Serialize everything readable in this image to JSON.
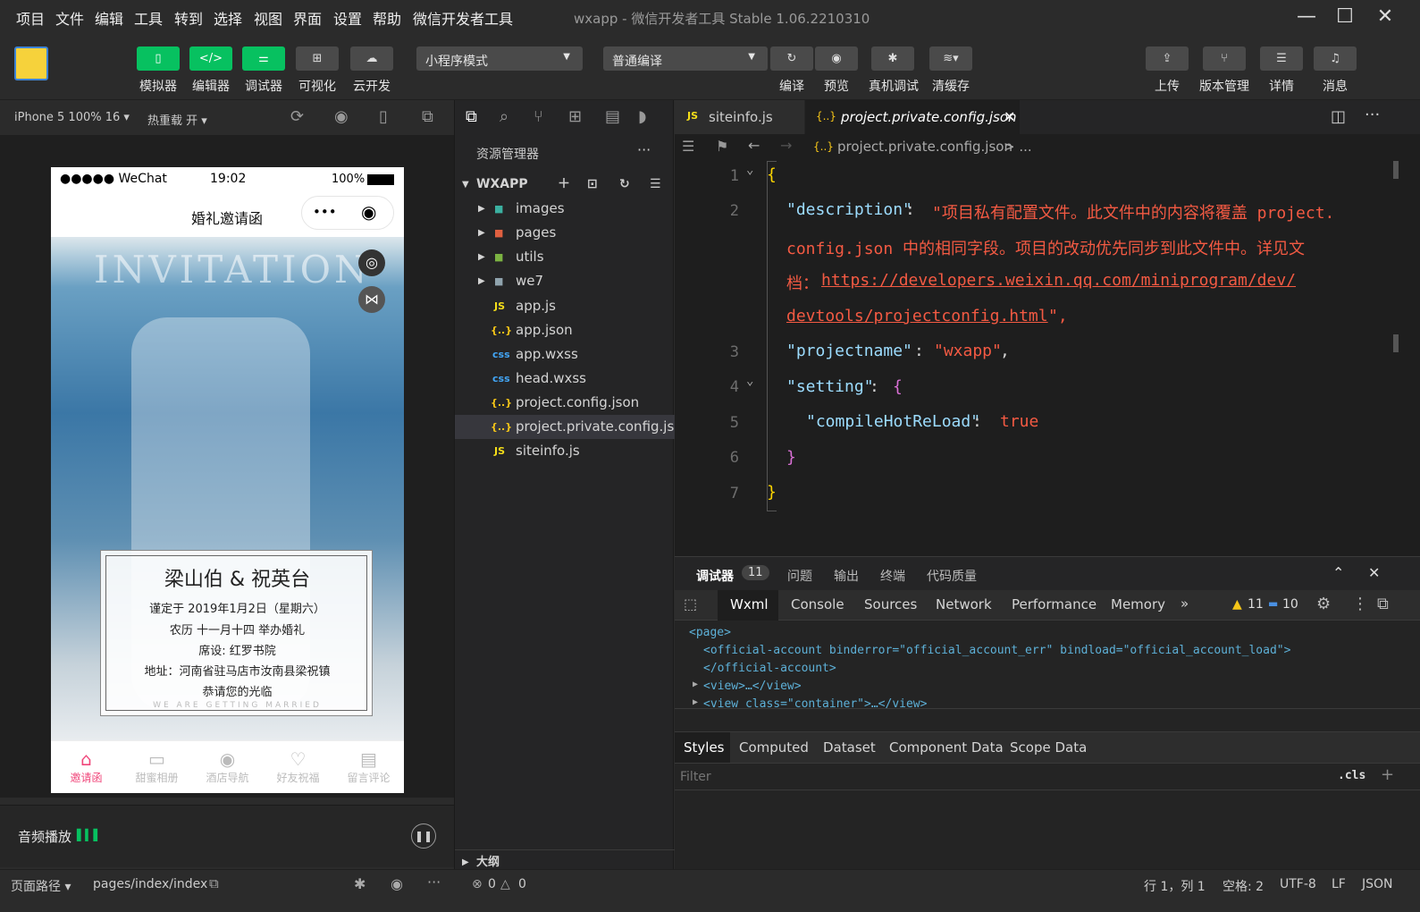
{
  "menu": [
    "项目",
    "文件",
    "编辑",
    "工具",
    "转到",
    "选择",
    "视图",
    "界面",
    "设置",
    "帮助",
    "微信开发者工具"
  ],
  "window_title": "wxapp - 微信开发者工具 Stable 1.06.2210310",
  "toolbar": {
    "simulator": "模拟器",
    "editor": "编辑器",
    "debugger": "调试器",
    "visual": "可视化",
    "cloud": "云开发",
    "mode_select": "小程序模式",
    "compile_select": "普通编译",
    "compile": "编译",
    "preview": "预览",
    "real_debug": "真机调试",
    "clear_cache": "清缓存",
    "upload": "上传",
    "version": "版本管理",
    "details": "详情",
    "messages": "消息"
  },
  "simulator": {
    "device": "iPhone 5 100% 16",
    "hot_reload": "热重载 开",
    "status_carrier": "●●●●● WeChat",
    "status_time": "19:02",
    "status_battery": "100%",
    "page_title": "婚礼邀请函",
    "banner_text": "INVITATION",
    "names": "梁山伯  &  祝英台",
    "card_lines": [
      "谨定于 2019年1月2日（星期六）",
      "农历 十一月十四 举办婚礼",
      "席设: 红罗书院",
      "地址：河南省驻马店市汝南县梁祝镇",
      "恭请您的光临"
    ],
    "card_footer": "WE ARE GETTING MARRIED",
    "tabs": [
      "邀请函",
      "甜蜜相册",
      "酒店导航",
      "好友祝福",
      "留言评论"
    ],
    "audio_label": "音频播放"
  },
  "explorer": {
    "title": "资源管理器",
    "root": "WXAPP",
    "folders": [
      "images",
      "pages",
      "utils",
      "we7"
    ],
    "files": [
      {
        "name": "app.js",
        "type": "JS"
      },
      {
        "name": "app.json",
        "type": "{..}"
      },
      {
        "name": "app.wxss",
        "type": "css"
      },
      {
        "name": "head.wxss",
        "type": "css"
      },
      {
        "name": "project.config.json",
        "type": "{..}"
      },
      {
        "name": "project.private.config.js...",
        "type": "{..}"
      },
      {
        "name": "siteinfo.js",
        "type": "JS"
      }
    ],
    "outline": "大纲"
  },
  "editor": {
    "tabs": [
      "siteinfo.js",
      "project.private.config.json"
    ],
    "breadcrumb": "project.private.config.json",
    "breadcrumb_more": "...",
    "line_numbers": [
      "1",
      "2",
      "3",
      "4",
      "5",
      "6",
      "7"
    ],
    "code": {
      "l1": "{",
      "l2_key": "\"description\"",
      "l2_val_a": "\"项目私有配置文件。此文件中的内容将覆盖 project.",
      "l2_val_b": "config.json 中的相同字段。项目的改动优先同步到此文件中。详见文",
      "l2_val_c": "档：",
      "l2_link_a": "https://developers.weixin.qq.com/miniprogram/dev/",
      "l2_link_b": "devtools/projectconfig.html",
      "l2_end": "\",",
      "l3_key": "\"projectname\"",
      "l3_val": "\"wxapp\"",
      "l4_key": "\"setting\"",
      "l5_key": "\"compileHotReLoad\"",
      "l5_val": "true",
      "l6": "}",
      "l7": "}"
    }
  },
  "devtools": {
    "panel_tabs": [
      "调试器",
      "问题",
      "输出",
      "终端",
      "代码质量"
    ],
    "badge": "11",
    "tabs": [
      "Wxml",
      "Console",
      "Sources",
      "Network",
      "Performance",
      "Memory"
    ],
    "warnings": "11",
    "infos": "10",
    "dom": [
      "<page>",
      "<official-account binderror=\"official_account_err\" bindload=\"official_account_load\">",
      "</official-account>",
      "<view>…</view>",
      "<view class=\"container\">…</view>"
    ],
    "style_tabs": [
      "Styles",
      "Computed",
      "Dataset",
      "Component Data",
      "Scope Data"
    ],
    "filter_placeholder": "Filter",
    "cls": ".cls"
  },
  "statusbar": {
    "page_path_label": "页面路径",
    "page_path": "pages/index/index",
    "errors": "0",
    "warnings": "0",
    "cursor": "行 1，列 1",
    "spaces": "空格: 2",
    "encoding": "UTF-8",
    "eol": "LF",
    "lang": "JSON"
  },
  "colors": {
    "accent": "#07c160",
    "pink": "#f0467a",
    "string": "#f45a43",
    "key": "#9cdcfe"
  }
}
